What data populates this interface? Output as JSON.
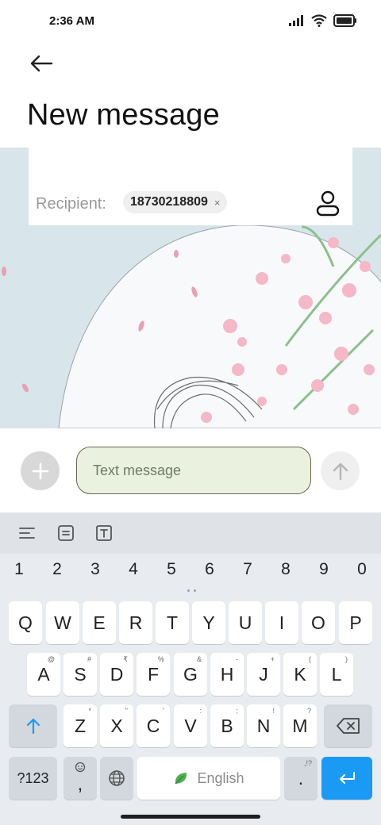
{
  "status_bar": {
    "time": "2:36 AM"
  },
  "header": {
    "title": "New message"
  },
  "recipient": {
    "label": "Recipient:",
    "chip_value": "18730218809",
    "chip_remove": "×"
  },
  "compose": {
    "placeholder": "Text message"
  },
  "keyboard": {
    "numbers": [
      "1",
      "2",
      "3",
      "4",
      "5",
      "6",
      "7",
      "8",
      "9",
      "0"
    ],
    "row1": [
      "Q",
      "W",
      "E",
      "R",
      "T",
      "Y",
      "U",
      "I",
      "O",
      "P"
    ],
    "row2": [
      "A",
      "S",
      "D",
      "F",
      "G",
      "H",
      "J",
      "K",
      "L"
    ],
    "row2_hints": [
      "@",
      "#",
      "₹",
      "%",
      "&",
      "-",
      "+",
      "(",
      ")"
    ],
    "row3": [
      "Z",
      "X",
      "C",
      "V",
      "B",
      "N",
      "M"
    ],
    "row3_hints": [
      "*",
      "\"",
      "'",
      ":",
      ";",
      "!",
      "?"
    ],
    "symbols_label": "?123",
    "comma_label": ",",
    "space_label": "English",
    "period_label": ".",
    "period_hint": ",!?"
  },
  "colors": {
    "accent": "#1a9af5",
    "compose_field": "#eaf2df",
    "wallpaper": "#d8e6ec",
    "leaf": "#4caf50"
  }
}
